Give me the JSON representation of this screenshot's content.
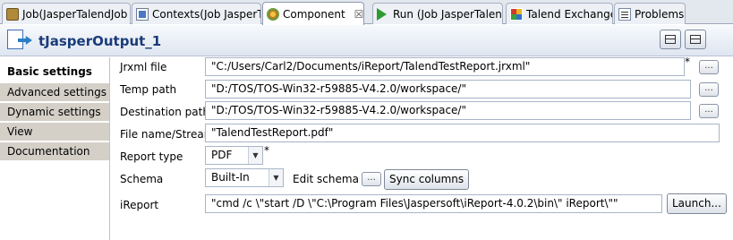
{
  "tabs": [
    {
      "label": "Job(JasperTalendJob",
      "icon": "job-icon"
    },
    {
      "label": "Contexts(Job JasperTal",
      "icon": "contexts-icon"
    },
    {
      "label": "Component",
      "icon": "component-icon",
      "active": true,
      "close": "☒"
    },
    {
      "label": "Run (Job JasperTalend",
      "icon": "run-icon"
    },
    {
      "label": "Talend Exchange",
      "icon": "talend-exchange-icon"
    },
    {
      "label": "Problems",
      "icon": "problems-icon"
    }
  ],
  "component": {
    "title": "tJasperOutput_1",
    "icon": "jasper-output-icon"
  },
  "sidebar": {
    "items": [
      {
        "label": "Basic settings",
        "active": true
      },
      {
        "label": "Advanced settings"
      },
      {
        "label": "Dynamic settings"
      },
      {
        "label": "View"
      },
      {
        "label": "Documentation"
      }
    ]
  },
  "form": {
    "jrxml_label": "Jrxml file",
    "jrxml_value": "\"C:/Users/Carl2/Documents/iReport/TalendTestReport.jrxml\"",
    "temp_label": "Temp path",
    "temp_value": "\"D:/TOS/TOS-Win32-r59885-V4.2.0/workspace/\"",
    "dest_label": "Destination path",
    "dest_value": "\"D:/TOS/TOS-Win32-r59885-V4.2.0/workspace/\"",
    "file_label": "File name/Stream",
    "file_value": "\"TalendTestReport.pdf\"",
    "report_type_label": "Report type",
    "report_type_value": "PDF",
    "schema_label": "Schema",
    "schema_value": "Built-In",
    "edit_schema_label": "Edit schema",
    "sync_label": "Sync columns",
    "ireport_label": "iReport",
    "ireport_value": "\"cmd /c \\\"start /D \\\"C:\\Program Files\\Jaspersoft\\iReport-4.0.2\\bin\\\" iReport\\\"\"",
    "launch_label": "Launch...",
    "dots": "...",
    "required_mark": "*",
    "dropdown_arrow": "▼"
  }
}
